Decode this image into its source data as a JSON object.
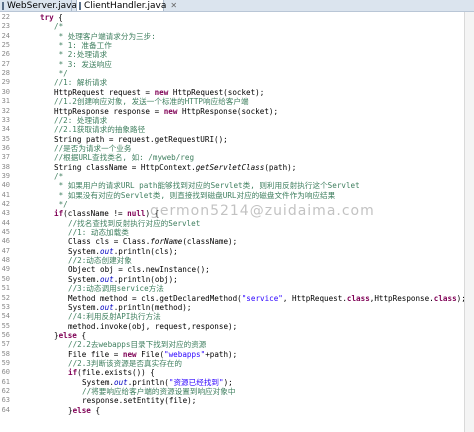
{
  "tabs": [
    {
      "label": "WebServer.java",
      "active": false
    },
    {
      "label": "ClientHandler.java",
      "active": true
    }
  ],
  "watermark": "germon5214@zuidaima.com",
  "colors": {
    "keyword": "#7f0055",
    "comment": "#3f7f5f",
    "string": "#2a00ff",
    "field": "#0000c0"
  },
  "code_lines": [
    {
      "no": "22",
      "indent": 2,
      "seg": [
        [
          "kw",
          "try"
        ],
        [
          "n",
          " {"
        ]
      ]
    },
    {
      "no": "23",
      "indent": 3,
      "seg": [
        [
          "cm",
          "/*"
        ]
      ]
    },
    {
      "no": "24",
      "indent": 3,
      "seg": [
        [
          "cm",
          " * 处理客户端请求分为三步:"
        ]
      ]
    },
    {
      "no": "25",
      "indent": 3,
      "seg": [
        [
          "cm",
          " * 1: 准备工作"
        ]
      ]
    },
    {
      "no": "26",
      "indent": 3,
      "seg": [
        [
          "cm",
          " * 2:处理请求"
        ]
      ]
    },
    {
      "no": "27",
      "indent": 3,
      "seg": [
        [
          "cm",
          " * 3: 发送响应"
        ]
      ]
    },
    {
      "no": "28",
      "indent": 3,
      "seg": [
        [
          "cm",
          " */"
        ]
      ]
    },
    {
      "no": "29",
      "indent": 3,
      "seg": [
        [
          "cm",
          "//1: 解析请求"
        ]
      ]
    },
    {
      "no": "30",
      "indent": 3,
      "seg": [
        [
          "n",
          "HttpRequest request = "
        ],
        [
          "kw",
          "new"
        ],
        [
          "n",
          " HttpRequest(socket);"
        ]
      ]
    },
    {
      "no": "31",
      "indent": 3,
      "seg": [
        [
          "cm",
          "//1.2创建响应对象, 发送一个标准的HTTP响应给客户端"
        ]
      ]
    },
    {
      "no": "32",
      "indent": 3,
      "seg": [
        [
          "n",
          "HttpResponse response = "
        ],
        [
          "kw",
          "new"
        ],
        [
          "n",
          " HttpResponse(socket);"
        ]
      ]
    },
    {
      "no": "33",
      "indent": 3,
      "seg": [
        [
          "cm",
          "//2: 处理请求"
        ]
      ]
    },
    {
      "no": "34",
      "indent": 3,
      "seg": [
        [
          "cm",
          "//2.1获取请求的抽象路径"
        ]
      ]
    },
    {
      "no": "35",
      "indent": 3,
      "seg": [
        [
          "n",
          "String path = request.getRequestURI();"
        ]
      ]
    },
    {
      "no": "36",
      "indent": 3,
      "seg": [
        [
          "cm",
          "//是否为请求一个业务"
        ]
      ]
    },
    {
      "no": "37",
      "indent": 3,
      "seg": [
        [
          "cm",
          "//根据URL查找类名, 如: /myweb/reg"
        ]
      ]
    },
    {
      "no": "38",
      "indent": 3,
      "seg": [
        [
          "n",
          "String className = HttpContext."
        ],
        [
          "mi",
          "getServletClass"
        ],
        [
          "n",
          "(path);"
        ]
      ]
    },
    {
      "no": "39",
      "indent": 3,
      "seg": [
        [
          "cm",
          "/*"
        ]
      ]
    },
    {
      "no": "40",
      "indent": 3,
      "seg": [
        [
          "cm",
          " * 如果用户的请求URL path能够找到对应的Servlet类, 则利用反射执行这个Servlet"
        ]
      ]
    },
    {
      "no": "41",
      "indent": 3,
      "seg": [
        [
          "cm",
          " * 如果没有对应的Servlet类, 则直接找到磁盘URL对应的磁盘文件作为响应结果"
        ]
      ]
    },
    {
      "no": "42",
      "indent": 3,
      "seg": [
        [
          "cm",
          " */"
        ]
      ]
    },
    {
      "no": "43",
      "indent": 3,
      "seg": [
        [
          "kw",
          "if"
        ],
        [
          "n",
          "(className != "
        ],
        [
          "kw",
          "null"
        ],
        [
          "n",
          ") {"
        ]
      ]
    },
    {
      "no": "44",
      "indent": 4,
      "seg": [
        [
          "cm",
          "//找名查找到反射执行对应的Servlet"
        ]
      ]
    },
    {
      "no": "45",
      "indent": 4,
      "seg": [
        [
          "cm",
          "//1: 动态加载类"
        ]
      ]
    },
    {
      "no": "46",
      "indent": 4,
      "seg": [
        [
          "n",
          "Class cls = Class."
        ],
        [
          "mi",
          "forName"
        ],
        [
          "n",
          "(className);"
        ]
      ]
    },
    {
      "no": "47",
      "indent": 4,
      "seg": [
        [
          "n",
          "System."
        ],
        [
          "fd",
          "out"
        ],
        [
          "n",
          ".println(cls);"
        ]
      ]
    },
    {
      "no": "48",
      "indent": 4,
      "seg": [
        [
          "cm",
          "//2:动态创建对象"
        ]
      ]
    },
    {
      "no": "49",
      "indent": 4,
      "seg": [
        [
          "n",
          "Object obj = cls.newInstance();"
        ]
      ]
    },
    {
      "no": "50",
      "indent": 4,
      "seg": [
        [
          "n",
          "System."
        ],
        [
          "fd",
          "out"
        ],
        [
          "n",
          ".println(obj);"
        ]
      ]
    },
    {
      "no": "51",
      "indent": 4,
      "seg": [
        [
          "cm",
          "//3:动态调用service方法"
        ]
      ]
    },
    {
      "no": "52",
      "indent": 4,
      "seg": [
        [
          "n",
          "Method method = cls.getDeclaredMethod("
        ],
        [
          "st",
          "\"service\""
        ],
        [
          "n",
          ", HttpRequest."
        ],
        [
          "kw",
          "class"
        ],
        [
          "n",
          ",HttpResponse."
        ],
        [
          "kw",
          "class"
        ],
        [
          "n",
          ");"
        ]
      ]
    },
    {
      "no": "53",
      "indent": 4,
      "seg": [
        [
          "n",
          "System."
        ],
        [
          "fd",
          "out"
        ],
        [
          "n",
          ".println(method);"
        ]
      ]
    },
    {
      "no": "54",
      "indent": 4,
      "seg": [
        [
          "cm",
          "//4:利用反射API执行方法"
        ]
      ]
    },
    {
      "no": "55",
      "indent": 4,
      "seg": [
        [
          "n",
          "method.invoke(obj, request,response);"
        ]
      ]
    },
    {
      "no": "56",
      "indent": 3,
      "seg": [
        [
          "n",
          "}"
        ],
        [
          "kw",
          "else"
        ],
        [
          "n",
          " {"
        ]
      ]
    },
    {
      "no": "57",
      "indent": 4,
      "seg": [
        [
          "cm",
          "//2.2去webapps目录下找到对应的资源"
        ]
      ]
    },
    {
      "no": "58",
      "indent": 4,
      "seg": [
        [
          "n",
          "File file = "
        ],
        [
          "kw",
          "new"
        ],
        [
          "n",
          " File("
        ],
        [
          "st",
          "\"webapps\""
        ],
        [
          "n",
          "+path);"
        ]
      ]
    },
    {
      "no": "59",
      "indent": 4,
      "seg": [
        [
          "cm",
          "//2.3判断该资源是否真实存在的"
        ]
      ]
    },
    {
      "no": "60",
      "indent": 4,
      "seg": [
        [
          "kw",
          "if"
        ],
        [
          "n",
          "(file.exists()) {"
        ]
      ]
    },
    {
      "no": "61",
      "indent": 5,
      "seg": [
        [
          "n",
          "System."
        ],
        [
          "fd",
          "out"
        ],
        [
          "n",
          ".println("
        ],
        [
          "st",
          "\"资源已经找到\""
        ],
        [
          "n",
          ");"
        ]
      ]
    },
    {
      "no": "62",
      "indent": 5,
      "seg": [
        [
          "cm",
          "//将要响应给客户端的资源设置到响应对象中"
        ]
      ]
    },
    {
      "no": "63",
      "indent": 5,
      "seg": [
        [
          "n",
          "response.setEntity(file);"
        ]
      ]
    },
    {
      "no": "64",
      "indent": 4,
      "seg": [
        [
          "n",
          "}"
        ],
        [
          "kw",
          "else"
        ],
        [
          "n",
          " {"
        ]
      ]
    }
  ]
}
